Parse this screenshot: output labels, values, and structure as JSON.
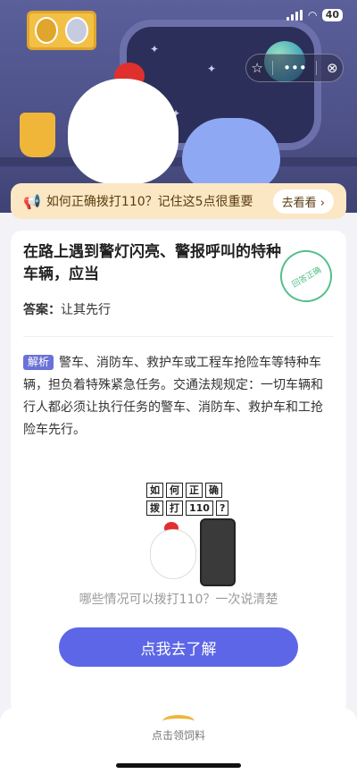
{
  "status_bar": {
    "battery": "40"
  },
  "banner": {
    "text": "如何正确拨打110？记住这5点很重要",
    "button": "去看看 ›"
  },
  "question": {
    "title": "在路上遇到警灯闪亮、警报呼叫的特种车辆，应当",
    "stamp": "回答正确",
    "answer_label": "答案：",
    "answer_value": "让其先行"
  },
  "explanation": {
    "tag": "解析",
    "text": "警车、消防车、救护车或工程车抢险车等特种车辆，担负着特殊紧急任务。交通法规规定：一切车辆和行人都必须让执行任务的警车、消防车、救护车和工抢险车先行。"
  },
  "illustration": {
    "row1": [
      "如",
      "何",
      "正",
      "确"
    ],
    "row2": [
      "拨",
      "打",
      "110",
      "?"
    ]
  },
  "promo": {
    "subtitle": "哪些情况可以拨打110？一次说清楚",
    "cta": "点我去了解"
  },
  "footer": {
    "label": "点击领饲料"
  }
}
